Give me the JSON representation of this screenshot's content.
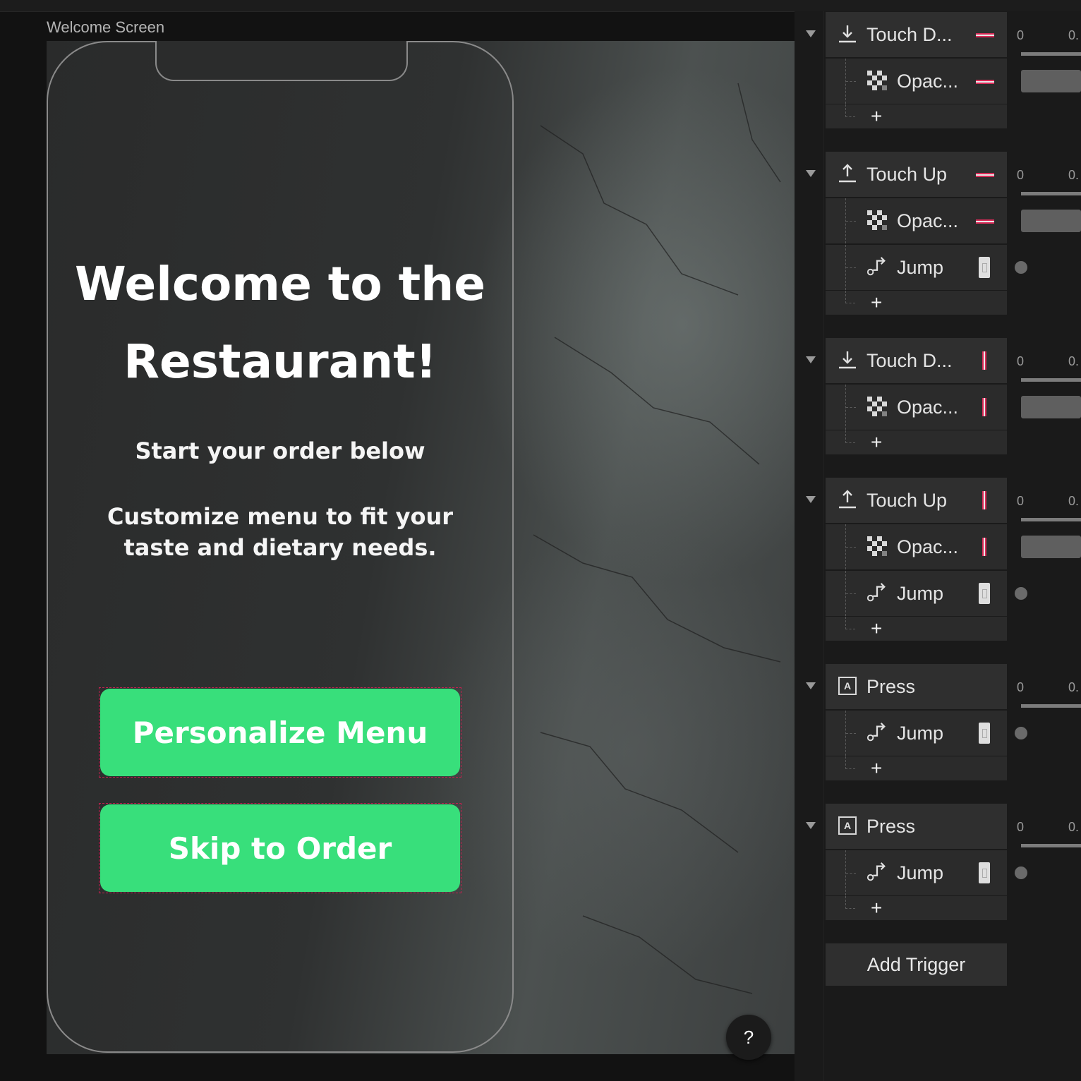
{
  "canvas": {
    "title": "Welcome Screen",
    "heading_line1": "Welcome to the",
    "heading_line2": "Restaurant!",
    "subtitle": "Start your order below",
    "description": "Customize menu to fit your taste and dietary needs.",
    "primary_button": "Personalize Menu",
    "secondary_button": "Skip to Order",
    "help_label": "?"
  },
  "interactions": {
    "add_trigger_label": "Add Trigger",
    "add_action_label": "+",
    "timeline_start": "0",
    "timeline_next": "0.",
    "triggers": [
      {
        "label": "Touch D...",
        "icon": "touch-down-icon",
        "indicator": "horizontal",
        "actions": [
          {
            "label": "Opac...",
            "icon": "opacity-icon",
            "indicator": "horizontal"
          }
        ]
      },
      {
        "label": "Touch Up",
        "icon": "touch-up-icon",
        "indicator": "horizontal",
        "actions": [
          {
            "label": "Opac...",
            "icon": "opacity-icon",
            "indicator": "horizontal"
          },
          {
            "label": "Jump",
            "icon": "jump-icon",
            "indicator": "jump"
          }
        ]
      },
      {
        "label": "Touch D...",
        "icon": "touch-down-icon",
        "indicator": "vertical",
        "actions": [
          {
            "label": "Opac...",
            "icon": "opacity-icon",
            "indicator": "vertical"
          }
        ]
      },
      {
        "label": "Touch Up",
        "icon": "touch-up-icon",
        "indicator": "vertical",
        "actions": [
          {
            "label": "Opac...",
            "icon": "opacity-icon",
            "indicator": "vertical"
          },
          {
            "label": "Jump",
            "icon": "jump-icon",
            "indicator": "jump"
          }
        ]
      },
      {
        "label": "Press",
        "icon": "press-icon",
        "indicator": "none",
        "actions": [
          {
            "label": "Jump",
            "icon": "jump-icon",
            "indicator": "jump"
          }
        ]
      },
      {
        "label": "Press",
        "icon": "press-icon",
        "indicator": "none",
        "actions": [
          {
            "label": "Jump",
            "icon": "jump-icon",
            "indicator": "jump"
          }
        ]
      }
    ]
  },
  "colors": {
    "accent_green": "#38df7b",
    "selection_red": "#d82a57",
    "panel_bg": "#1a1a1a"
  }
}
